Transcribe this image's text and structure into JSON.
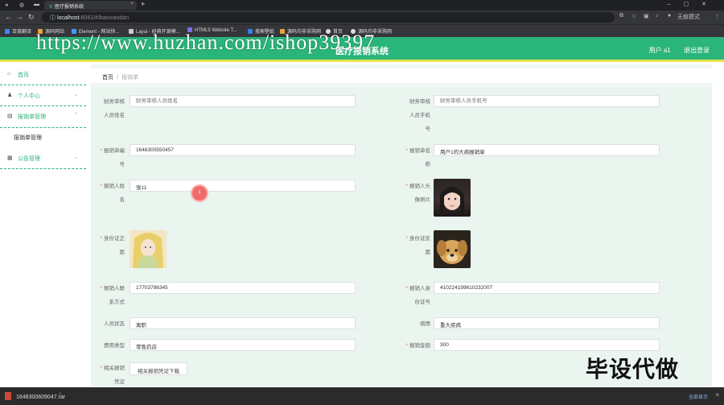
{
  "browser": {
    "tab_title": "医疗报销系统",
    "url_host": "localhost",
    "url_rest": ":8081/#/baoxiaodan",
    "profile_label": "无痕模式",
    "bookmarks": [
      "百度翻译",
      "源码网站",
      "Element - 网站快...",
      "Layui - 经典开源模...",
      "HTML5 Website T...",
      "搜索壁纸",
      "源码均非采购网",
      "首页",
      "源码均非采购网"
    ]
  },
  "watermark": "https://www.huzhan.com/ishop39397",
  "header": {
    "title": "医疗报销系统",
    "user_label": "用户 a1",
    "logout_label": "退出登录"
  },
  "sidebar": {
    "items": [
      {
        "label": "首页"
      },
      {
        "label": "个人中心"
      },
      {
        "label": "报销单管理"
      },
      {
        "label": "公告管理"
      }
    ],
    "sub_item": "报销单管理"
  },
  "breadcrumb": {
    "home": "首页",
    "sep": "/",
    "current": "报销单"
  },
  "form": {
    "caiwu_shenhe_name": {
      "label1": "财务审核",
      "label2": "人员姓名",
      "placeholder": "财务审核人员姓名"
    },
    "caiwu_shenhe_phone": {
      "label1": "财务审核",
      "label2": "人员手机",
      "label3": "号",
      "placeholder": "财务审核人员手机号"
    },
    "baoxiao_bianhao": {
      "label1": "报销单编",
      "label2": "号",
      "value": "1648300550457"
    },
    "baoxiao_mingcheng": {
      "label1": "报销单名",
      "label2": "称",
      "value": "用户1的大病报销单"
    },
    "baoxiaoren_name": {
      "label1": "报销人姓",
      "label2": "名",
      "value": "张11"
    },
    "baoxiaoren_photo": {
      "label1": "报销人头",
      "label2": "像照片"
    },
    "idcard_front": {
      "label1": "身份证正",
      "label2": "面"
    },
    "idcard_back": {
      "label1": "身份证反",
      "label2": "面"
    },
    "baoxiaoren_phone": {
      "label1": "报销人联",
      "label2": "系方式",
      "value": "17703786345"
    },
    "baoxiaoren_idcard": {
      "label1": "报销人身",
      "label2": "份证号",
      "value": "410224199610232007"
    },
    "renyuan_zhuangtai": {
      "label": "人员状态",
      "value": "离职"
    },
    "bingqing": {
      "label": "病情",
      "value": "重大疾病"
    },
    "feiyong_leixing": {
      "label": "费用类型",
      "value": "零售药店"
    },
    "baoxiao_jine": {
      "label": "报销金额",
      "value": "300"
    },
    "pingzheng": {
      "label1": "相关报销",
      "label2": "凭证",
      "button": "相关报销凭证下载"
    }
  },
  "cursor_glyph": "I",
  "promo_text": "毕设代做",
  "download_bar": {
    "file": "1648300609047.rar",
    "show_all": "全部显示"
  },
  "colors": {
    "accent": "#2ab57a",
    "header_border": "#e9e34a",
    "required": "#f56c6c"
  }
}
